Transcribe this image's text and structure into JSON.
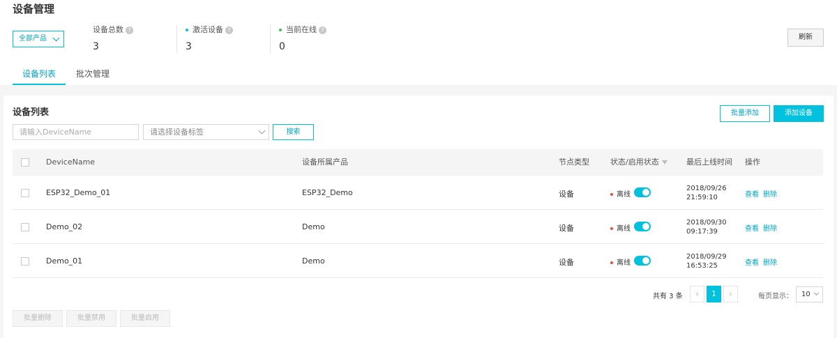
{
  "header": {
    "title": "设备管理"
  },
  "product_filter": {
    "value": "全部产品"
  },
  "stats": [
    {
      "label": "设备总数",
      "value": "3",
      "dot_color": ""
    },
    {
      "label": "激活设备",
      "value": "3",
      "dot_color": "#00c1de"
    },
    {
      "label": "当前在线",
      "value": "0",
      "dot_color": "#3fbf5a"
    }
  ],
  "help_icon": "?",
  "refresh_label": "刷新",
  "tabs": [
    {
      "label": "设备列表",
      "active": true
    },
    {
      "label": "批次管理",
      "active": false
    }
  ],
  "list": {
    "title": "设备列表",
    "bulk_add_label": "批量添加",
    "add_device_label": "添加设备",
    "search_placeholder": "请输入DeviceName",
    "tag_placeholder": "请选择设备标签",
    "search_label": "搜索"
  },
  "table": {
    "columns": [
      "DeviceName",
      "设备所属产品",
      "节点类型",
      "状态/启用状态",
      "最后上线时间",
      "操作"
    ],
    "rows": [
      {
        "name": "ESP32_Demo_01",
        "product": "ESP32_Demo",
        "node_type": "设备",
        "status": "离线",
        "enabled": true,
        "last_online_date": "2018/09/26",
        "last_online_time": "21:59:10",
        "action_view": "查看",
        "action_delete": "删除"
      },
      {
        "name": "Demo_02",
        "product": "Demo",
        "node_type": "设备",
        "status": "离线",
        "enabled": true,
        "last_online_date": "2018/09/30",
        "last_online_time": "09:17:39",
        "action_view": "查看",
        "action_delete": "删除"
      },
      {
        "name": "Demo_01",
        "product": "Demo",
        "node_type": "设备",
        "status": "离线",
        "enabled": true,
        "last_online_date": "2018/09/29",
        "last_online_time": "16:53:25",
        "action_view": "查看",
        "action_delete": "删除"
      }
    ]
  },
  "pagination": {
    "total_text": "共有 3 条",
    "prev": "‹",
    "current_page": "1",
    "next": "›",
    "per_page_label": "每页显示：",
    "per_page_value": "10"
  },
  "bulk_actions": [
    "批量删除",
    "批量禁用",
    "批量启用"
  ],
  "colors": {
    "accent": "#00c1de",
    "offline_dot": "#e84c3d"
  }
}
